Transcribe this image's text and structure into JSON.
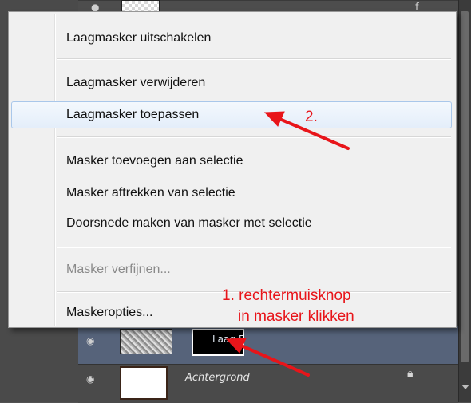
{
  "layers_panel": {
    "layers": [
      {
        "name": "Laag 5",
        "selected": true
      },
      {
        "name": "Achtergrond",
        "locked": true
      }
    ],
    "top_row_glyph": "f"
  },
  "context_menu": {
    "groups": [
      [
        {
          "label": "Laagmasker uitschakelen",
          "enabled": true
        }
      ],
      [
        {
          "label": "Laagmasker verwijderen",
          "enabled": true
        },
        {
          "label": "Laagmasker toepassen",
          "enabled": true,
          "highlighted": true
        }
      ],
      [
        {
          "label": "Masker toevoegen aan selectie",
          "enabled": true
        },
        {
          "label": "Masker aftrekken van selectie",
          "enabled": true
        },
        {
          "label": "Doorsnede maken van masker met selectie",
          "enabled": true
        }
      ],
      [
        {
          "label": "Masker verfijnen...",
          "enabled": false
        }
      ],
      [
        {
          "label": "Maskeropties...",
          "enabled": true
        }
      ]
    ]
  },
  "annotations": {
    "step1_line1": "1. rechtermuisknop",
    "step1_line2": "in masker klikken",
    "step2": "2.",
    "color": "#e8151a"
  },
  "icons": {
    "visibility": "eye-icon",
    "lock": "lock-icon"
  }
}
